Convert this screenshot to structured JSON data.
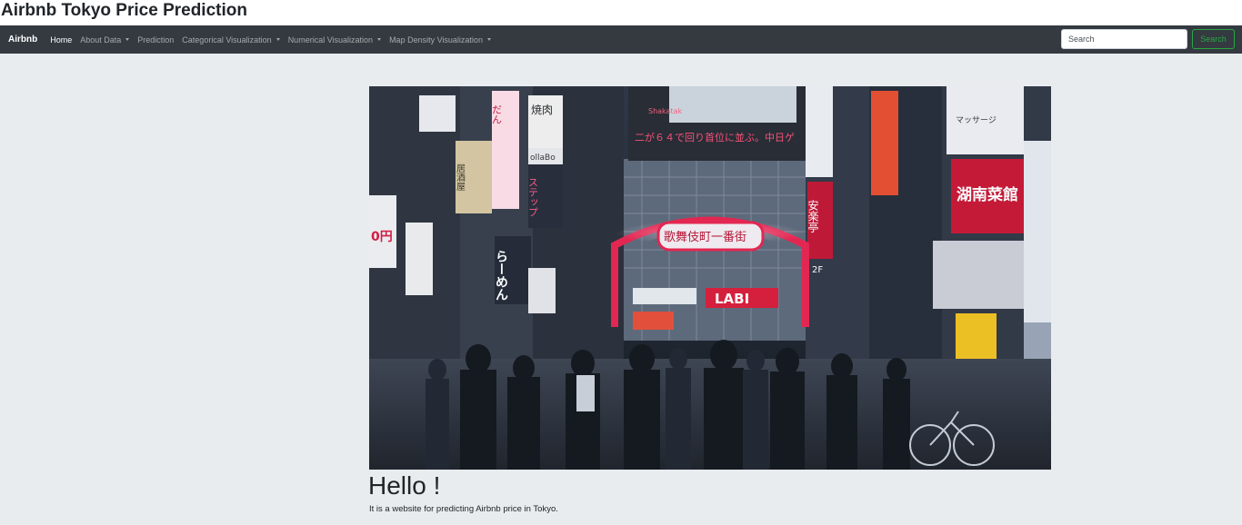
{
  "page": {
    "title": "Airbnb Tokyo Price Prediction"
  },
  "navbar": {
    "brand": "Airbnb",
    "items": [
      {
        "label": "Home",
        "active": true,
        "dropdown": false
      },
      {
        "label": "About Data",
        "active": false,
        "dropdown": true
      },
      {
        "label": "Prediction",
        "active": false,
        "dropdown": false
      },
      {
        "label": "Categorical Visualization",
        "active": false,
        "dropdown": true
      },
      {
        "label": "Numerical Visualization",
        "active": false,
        "dropdown": true
      },
      {
        "label": "Map Density Visualization",
        "active": false,
        "dropdown": true
      }
    ],
    "search": {
      "placeholder": "Search",
      "value": "",
      "button_label": "Search"
    }
  },
  "jumbotron": {
    "image": "tokyo-kabukicho-neon-street-photo",
    "heading": "Hello !",
    "text": "It is a website for predicting Airbnb price in Tokyo.",
    "photo_signs": {
      "gate_sign": "歌舞伎町一番街",
      "lab_sign": "LABI",
      "banner": "二が６４で回り首位に並ぶ。中日ゲ",
      "screen_brand": "Shakatak",
      "sign_1": "焼肉",
      "sign_2": "居酒屋",
      "sign_3": "ステップ",
      "sign_4": "湖南菜館",
      "sign_5": "マッサージ",
      "sign_6": "ollaBo",
      "sign_7": "安楽亭",
      "sign_8": "2F",
      "sign_9": "らーめん"
    }
  },
  "colors": {
    "navbar_bg": "#343a40",
    "page_bg": "#e9ecef",
    "search_accent": "#28a745"
  }
}
